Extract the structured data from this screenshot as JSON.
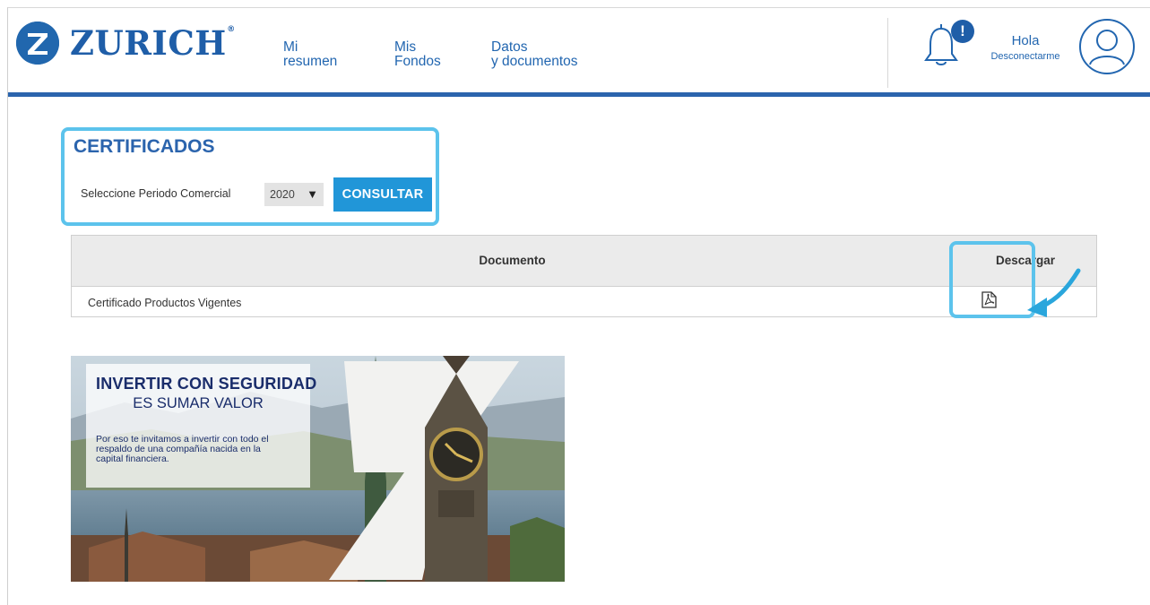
{
  "brand": {
    "name": "ZURICH",
    "registered": "®",
    "color": "#1f5ea8",
    "accent": "#5cc3ec",
    "button_color": "#2196d8"
  },
  "nav": {
    "items": [
      {
        "line1": "Mi",
        "line2": "resumen"
      },
      {
        "line1": "Mis",
        "line2": "Fondos"
      },
      {
        "line1": "Datos",
        "line2": "y documentos"
      }
    ]
  },
  "notifications": {
    "icon": "bell-icon",
    "badge": "!"
  },
  "user": {
    "greeting": "Hola",
    "logout_label": "Desconectarme",
    "avatar_icon": "user-icon"
  },
  "certificados": {
    "title": "CERTIFICADOS",
    "period_label": "Seleccione Periodo Comercial",
    "selected_year": "2020",
    "dropdown_arrow": "▼",
    "consultar_label": "CONSULTAR"
  },
  "table": {
    "headers": {
      "document": "Documento",
      "download": "Descargar"
    },
    "rows": [
      {
        "name": "Certificado Productos Vigentes",
        "download_icon": "pdf-icon"
      }
    ]
  },
  "banner": {
    "title": "INVERTIR CON SEGURIDAD",
    "subtitle": "ES SUMAR VALOR",
    "body_lines": [
      "Por eso te invitamos a invertir con todo el",
      "respaldo de una compañía nacida en la",
      "capital financiera."
    ]
  }
}
